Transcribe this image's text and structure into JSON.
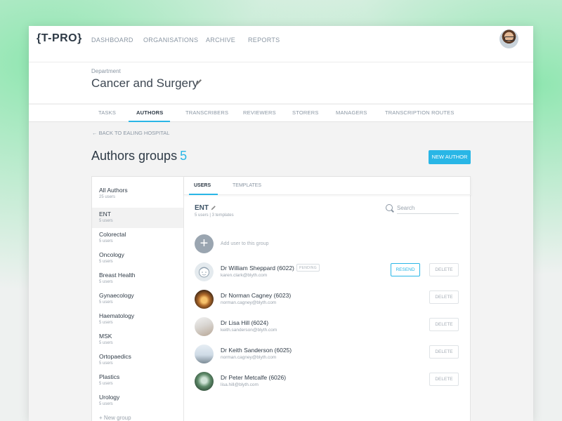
{
  "app": {
    "logo": "{T-PRO}"
  },
  "nav": {
    "items": [
      {
        "label": "DASHBOARD"
      },
      {
        "label": "ORGANISATIONS"
      },
      {
        "label": "ARCHIVE"
      },
      {
        "label": "REPORTS"
      }
    ]
  },
  "header": {
    "department_label": "Department",
    "department_name": "Cancer and Surgery"
  },
  "tabs": [
    {
      "label": "TASKS",
      "active": false
    },
    {
      "label": "AUTHORS",
      "active": true
    },
    {
      "label": "TRANSCRIBERS",
      "active": false
    },
    {
      "label": "REVIEWERS",
      "active": false
    },
    {
      "label": "STORERS",
      "active": false
    },
    {
      "label": "MANAGERS",
      "active": false
    },
    {
      "label": "TRANSCRIPTION ROUTES",
      "active": false
    }
  ],
  "back_link": "← BACK TO EALING HOSPITAL",
  "page": {
    "title": "Authors groups",
    "count": "5",
    "new_author_label": "NEW AUTHOR"
  },
  "groups": [
    {
      "name": "All Authors",
      "count": "25 users"
    },
    {
      "name": "ENT",
      "count": "5 users"
    },
    {
      "name": "Colorectal",
      "count": "5 users"
    },
    {
      "name": "Oncology",
      "count": "5 users"
    },
    {
      "name": "Breast Health",
      "count": "5 users"
    },
    {
      "name": "Gynaecology",
      "count": "5 users"
    },
    {
      "name": "Haematology",
      "count": "5 users"
    },
    {
      "name": "MSK",
      "count": "5 users"
    },
    {
      "name": "Ortopaedics",
      "count": "5 users"
    },
    {
      "name": "Plastics",
      "count": "5 users"
    },
    {
      "name": "Urology",
      "count": "5 users"
    }
  ],
  "new_group_label": "+ New group",
  "subtabs": [
    {
      "label": "USERS",
      "active": true
    },
    {
      "label": "TEMPLATES",
      "active": false
    }
  ],
  "selected_group": {
    "name": "ENT",
    "meta": "5 users | 3 templates"
  },
  "search": {
    "placeholder": "Search"
  },
  "add_user_label": "Add user to this group",
  "buttons": {
    "resend": "RESEND",
    "delete": "DELETE",
    "pending": "PENDING"
  },
  "users": [
    {
      "name": "Dr William Sheppard (6022)",
      "email": "karen.clark@blyth.com",
      "pending": true,
      "avatar": "placeholder-face-icon"
    },
    {
      "name": "Dr Norman Cagney (6023)",
      "email": "norman.cagney@blyth.com",
      "pending": false,
      "avatar": "photo"
    },
    {
      "name": "Dr Lisa Hill (6024)",
      "email": "keith.sanderson@blyth.com",
      "pending": false,
      "avatar": "photo"
    },
    {
      "name": "Dr Keith Sanderson (6025)",
      "email": "norman.cagney@blyth.com",
      "pending": false,
      "avatar": "photo"
    },
    {
      "name": "Dr Peter Metcalfe (6026)",
      "email": "lisa.hill@blyth.com",
      "pending": false,
      "avatar": "photo"
    }
  ],
  "colors": {
    "accent": "#29b6e6",
    "text_dark": "#2e3a46",
    "muted": "#8a96a3"
  }
}
